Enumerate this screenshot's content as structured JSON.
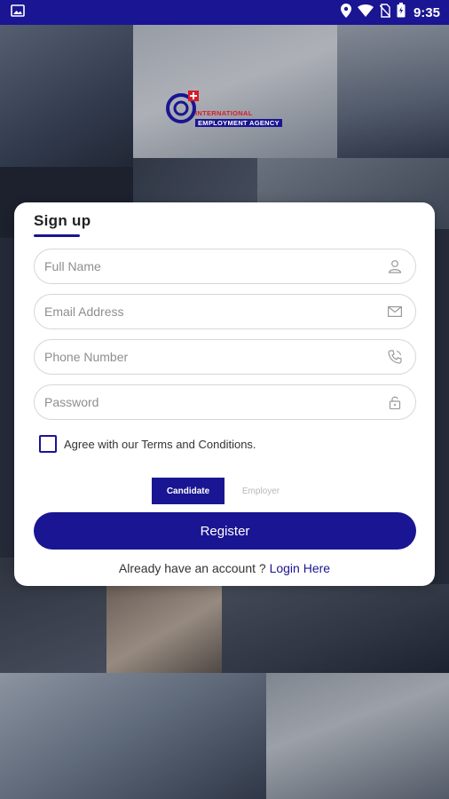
{
  "status_bar": {
    "time": "9:35",
    "icons": [
      "image-icon",
      "location-icon",
      "wifi-icon",
      "no-sim-icon",
      "battery-icon"
    ]
  },
  "logo": {
    "line1": "International",
    "line2": "Employment Agency"
  },
  "signup": {
    "title": "Sign up",
    "fields": {
      "full_name": {
        "placeholder": "Full Name",
        "icon": "user-icon"
      },
      "email": {
        "placeholder": "Email Address",
        "icon": "mail-icon"
      },
      "phone": {
        "placeholder": "Phone Number",
        "icon": "phone-icon"
      },
      "password": {
        "placeholder": "Password",
        "icon": "lock-icon"
      }
    },
    "agree_label": "Agree with our Terms and Conditions.",
    "roles": [
      "Candidate",
      "Employer"
    ],
    "selected_role": "Candidate",
    "register_label": "Register",
    "login_prompt": "Already have an account ?",
    "login_link": "Login Here"
  },
  "colors": {
    "primary": "#1a1592",
    "card_bg": "#ffffff",
    "placeholder": "#8e8e8e"
  }
}
